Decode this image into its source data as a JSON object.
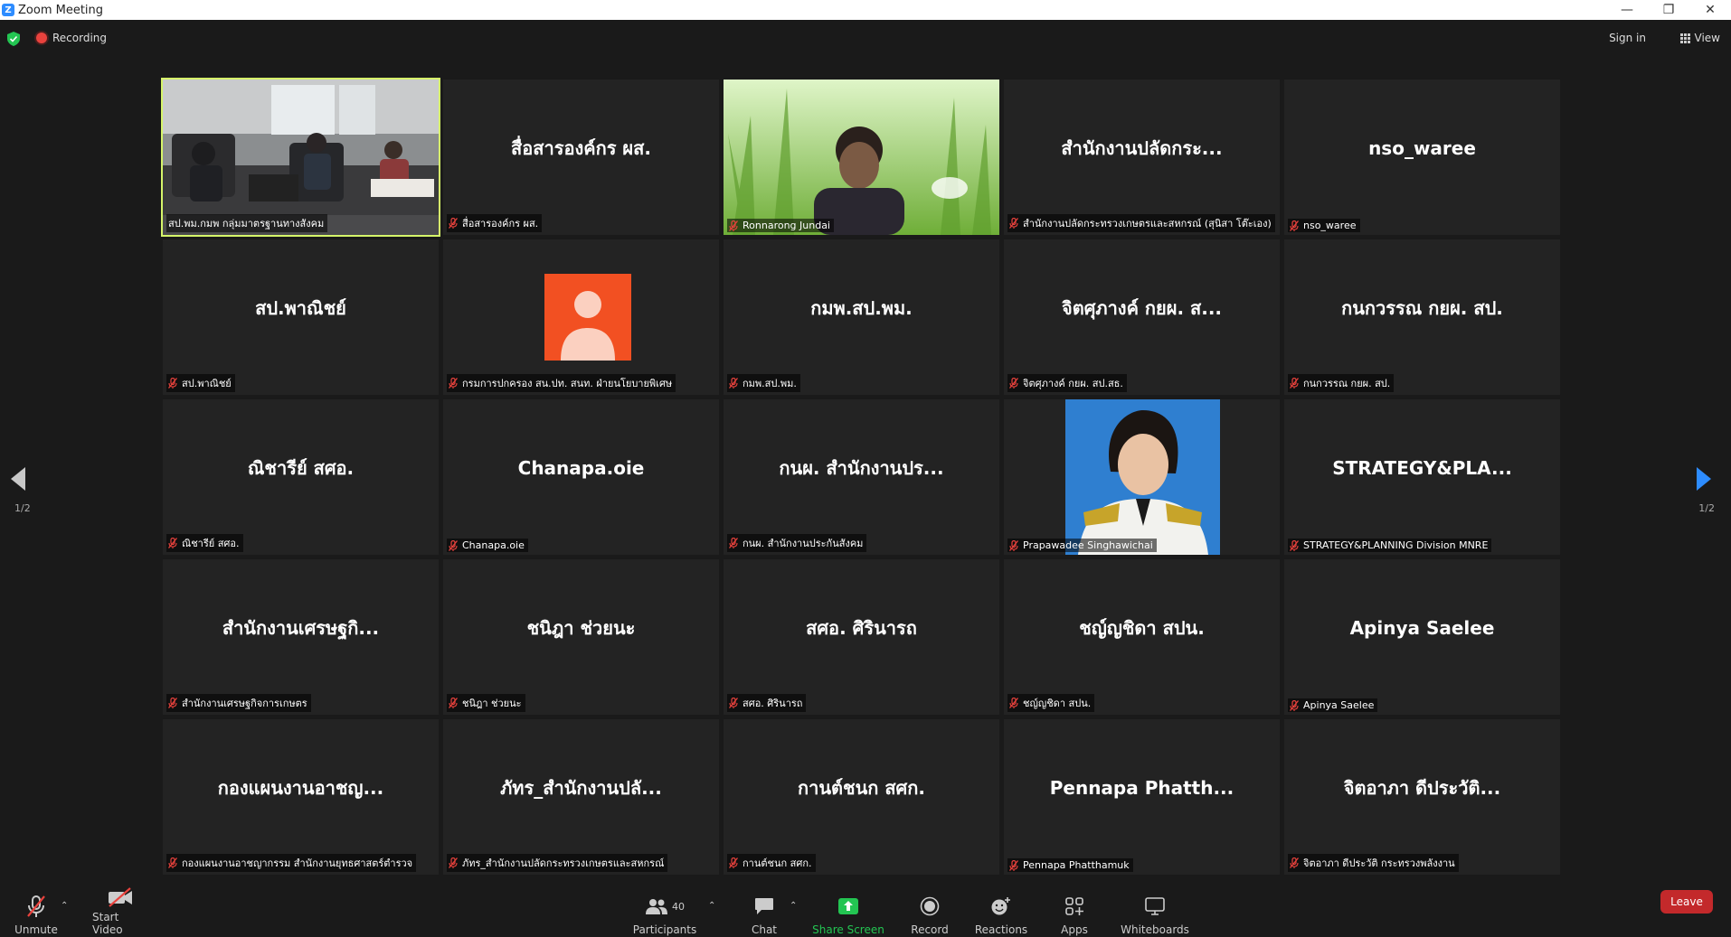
{
  "window": {
    "title": "Zoom Meeting",
    "logo_letter": "Z"
  },
  "topbar": {
    "recording_label": "Recording",
    "signin_label": "Sign in",
    "view_label": "View"
  },
  "pagination": {
    "left": "1/2",
    "right": "1/2"
  },
  "tiles": [
    {
      "display": "",
      "label": "สป.พม.กมพ กลุ่มมาตรฐานทางสังคม",
      "muted": false,
      "video": "meeting-room"
    },
    {
      "display": "สื่อสารองค์กร ผส.",
      "label": "สื่อสารองค์กร ผส.",
      "muted": true,
      "video": ""
    },
    {
      "display": "",
      "label": "Ronnarong Jundai",
      "muted": true,
      "video": "grass-background"
    },
    {
      "display": "สำนักงานปลัดกระ...",
      "label": "สำนักงานปลัดกระทรวงเกษตรและสหกรณ์ (สุนิสา โต๊ะเอง)",
      "muted": true,
      "video": ""
    },
    {
      "display": "nso_waree",
      "label": "nso_waree",
      "muted": true,
      "video": ""
    },
    {
      "display": "สป.พาณิชย์",
      "label": "สป.พาณิชย์",
      "muted": true,
      "video": ""
    },
    {
      "display": "",
      "label": "กรมการปกครอง สน.ปท. สนท. ฝ่ายนโยบายพิเศษ",
      "muted": true,
      "video": "avatar-placeholder"
    },
    {
      "display": "กมพ.สป.พม.",
      "label": "กมพ.สป.พม.",
      "muted": true,
      "video": ""
    },
    {
      "display": "จิตศุภางค์ กยผ. ส...",
      "label": "จิตศุภางค์ กยผ. สป.สธ.",
      "muted": true,
      "video": ""
    },
    {
      "display": "กนกวรรณ กยผ. สป.",
      "label": "กนกวรรณ กยผ. สป.",
      "muted": true,
      "video": ""
    },
    {
      "display": "ณิชารีย์ สศอ.",
      "label": "ณิชารีย์ สศอ.",
      "muted": true,
      "video": ""
    },
    {
      "display": "Chanapa.oie",
      "label": "Chanapa.oie",
      "muted": true,
      "video": ""
    },
    {
      "display": "กนผ. สำนักงานปร...",
      "label": "กนผ. สำนักงานประกันสังคม",
      "muted": true,
      "video": ""
    },
    {
      "display": "",
      "label": "Prapawadee Singhawichai",
      "muted": true,
      "video": "portrait-photo"
    },
    {
      "display": "STRATEGY&PLA...",
      "label": "STRATEGY&PLANNING Division MNRE",
      "muted": true,
      "video": ""
    },
    {
      "display": "สำนักงานเศรษฐกิ...",
      "label": "สำนักงานเศรษฐกิจการเกษตร",
      "muted": true,
      "video": ""
    },
    {
      "display": "ชนิฎา ช่วยนะ",
      "label": "ชนิฎา ช่วยนะ",
      "muted": true,
      "video": ""
    },
    {
      "display": "สศอ. ศิรินารถ",
      "label": "สศอ. ศิรินารถ",
      "muted": true,
      "video": ""
    },
    {
      "display": "ชญ์ญชิดา สปน.",
      "label": "ชญ์ญชิดา สปน.",
      "muted": true,
      "video": ""
    },
    {
      "display": "Apinya  Saelee",
      "label": "Apinya  Saelee",
      "muted": true,
      "video": ""
    },
    {
      "display": "กองแผนงานอาชญ...",
      "label": "กองแผนงานอาชญากรรม สำนักงานยุทธศาสตร์ตำรวจ",
      "muted": true,
      "video": ""
    },
    {
      "display": "ภัทร_สำนักงานปลั...",
      "label": "ภัทร_สำนักงานปลัดกระทรวงเกษตรและสหกรณ์",
      "muted": true,
      "video": ""
    },
    {
      "display": "กานต์ชนก สศก.",
      "label": "กานต์ชนก สศก.",
      "muted": true,
      "video": ""
    },
    {
      "display": "Pennapa  Phatth...",
      "label": "Pennapa Phatthamuk",
      "muted": true,
      "video": ""
    },
    {
      "display": "จิตอาภา ดีประวัติ...",
      "label": "จิตอาภา ดีประวัติ กระทรวงพลังงาน",
      "muted": true,
      "video": ""
    }
  ],
  "toolbar": {
    "unmute": "Unmute",
    "start_video": "Start Video",
    "participants": "Participants",
    "participants_count": "40",
    "chat": "Chat",
    "share_screen": "Share Screen",
    "record": "Record",
    "reactions": "Reactions",
    "apps": "Apps",
    "whiteboards": "Whiteboards",
    "leave": "Leave"
  },
  "colors": {
    "active_speaker": "#d6f56a",
    "share_green": "#23c552",
    "leave_red": "#c3292b",
    "accent_blue": "#2d8cff",
    "avatar_orange": "#f25022"
  }
}
